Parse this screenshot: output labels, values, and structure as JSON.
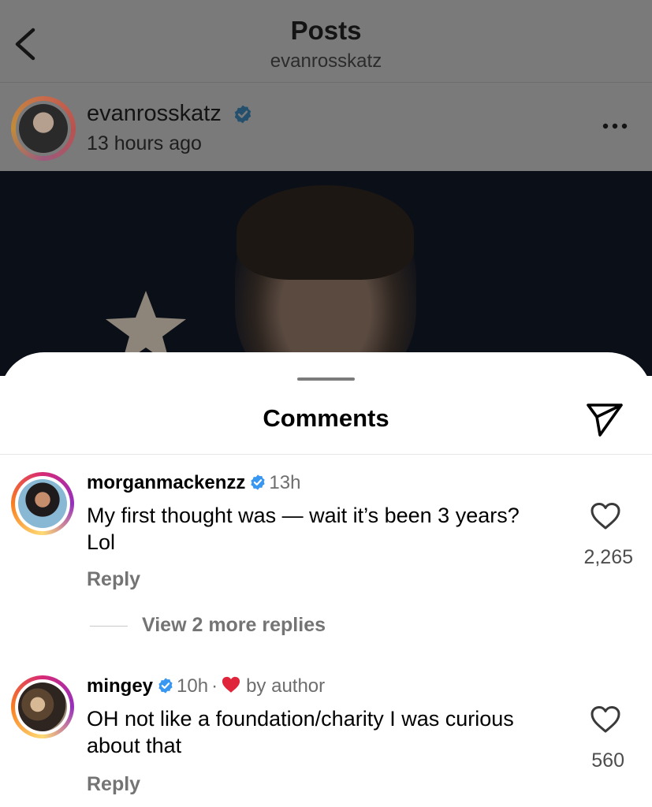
{
  "header": {
    "title": "Posts",
    "subtitle": "evanrosskatz",
    "back_icon": "chevron-left-icon"
  },
  "post": {
    "username": "evanrosskatz",
    "verified": true,
    "time": "13 hours ago",
    "more_icon": "more-horizontal-icon"
  },
  "comments_sheet": {
    "title": "Comments",
    "share_icon": "send-icon",
    "comments": [
      {
        "username": "morganmackenzz",
        "verified": true,
        "time": "13h",
        "text": "My first thought was — wait it’s been 3 years? Lol",
        "reply_label": "Reply",
        "likes": "2,265",
        "view_replies": "View 2 more replies"
      },
      {
        "username": "mingey",
        "verified": true,
        "time": "10h",
        "separator": "·",
        "liked_by_author": "by author",
        "text": "OH not like a foundation/charity I was curious about that",
        "reply_label": "Reply",
        "likes": "560"
      }
    ]
  },
  "colors": {
    "verified_blue": "#3897f0",
    "author_heart": "#e0243a",
    "overlay_gray": "#7a7a7a"
  }
}
